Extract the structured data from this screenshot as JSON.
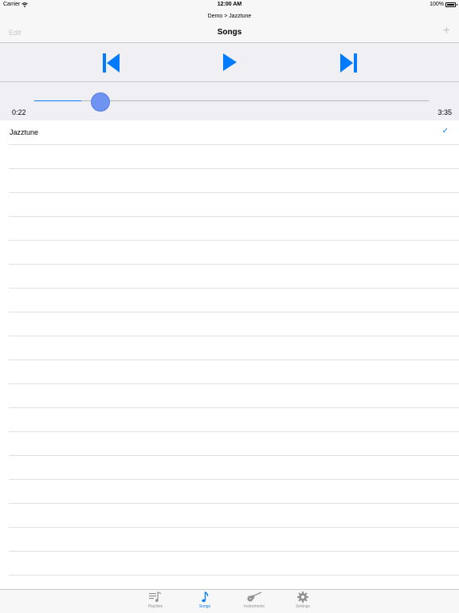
{
  "status_bar": {
    "carrier": "Carrier",
    "time": "12:00 AM",
    "battery": "100%"
  },
  "nav": {
    "breadcrumb": "Demo > Jazztune",
    "title": "Songs",
    "edit_label": "Edit",
    "add_label": "+"
  },
  "player": {
    "controls": [
      "skip-back",
      "play",
      "skip-forward"
    ],
    "elapsed": "0:22",
    "total": "3:35",
    "progress_fraction": 0.12
  },
  "songs": [
    {
      "name": "Jazztune",
      "selected": true,
      "check": "✓"
    }
  ],
  "tabs": [
    {
      "label": "Playlists",
      "icon": "playlist-icon",
      "active": false
    },
    {
      "label": "Songs",
      "icon": "music-note-icon",
      "active": true
    },
    {
      "label": "Instruments",
      "icon": "guitar-icon",
      "active": false
    },
    {
      "label": "Settings",
      "icon": "gear-icon",
      "active": false
    }
  ],
  "colors": {
    "accent": "#007aff",
    "thumb": "#6f93f0",
    "inactive": "#929292"
  }
}
